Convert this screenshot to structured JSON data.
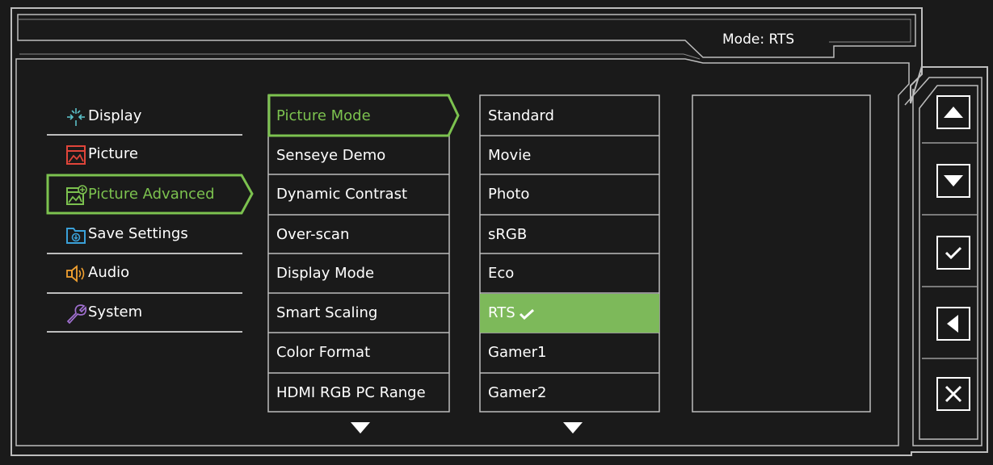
{
  "header": {
    "mode_label": "Mode: RTS"
  },
  "menu1": [
    {
      "label": "Display",
      "icon": "display-icon",
      "color": "#5bc0c8"
    },
    {
      "label": "Picture",
      "icon": "picture-icon",
      "color": "#e0453a"
    },
    {
      "label": "Picture Advanced",
      "icon": "picture-advanced-icon",
      "color": "#7cc24f",
      "active": true
    },
    {
      "label": "Save Settings",
      "icon": "save-settings-icon",
      "color": "#3aa0d8"
    },
    {
      "label": "Audio",
      "icon": "audio-icon",
      "color": "#f0a030"
    },
    {
      "label": "System",
      "icon": "system-icon",
      "color": "#a070d0"
    }
  ],
  "menu2": [
    {
      "label": "Picture Mode",
      "active": true
    },
    {
      "label": "Senseye Demo"
    },
    {
      "label": "Dynamic Contrast"
    },
    {
      "label": "Over-scan"
    },
    {
      "label": "Display Mode"
    },
    {
      "label": "Smart Scaling"
    },
    {
      "label": "Color Format"
    },
    {
      "label": "HDMI RGB PC Range"
    }
  ],
  "menu3": [
    {
      "label": "Standard"
    },
    {
      "label": "Movie"
    },
    {
      "label": "Photo"
    },
    {
      "label": "sRGB"
    },
    {
      "label": "Eco"
    },
    {
      "label": "RTS",
      "selected": true
    },
    {
      "label": "Gamer1"
    },
    {
      "label": "Gamer2"
    }
  ],
  "side_buttons": [
    {
      "name": "up-button",
      "icon": "triangle-up-icon"
    },
    {
      "name": "down-button",
      "icon": "triangle-down-icon"
    },
    {
      "name": "confirm-button",
      "icon": "checkmark-icon"
    },
    {
      "name": "back-button",
      "icon": "triangle-left-icon"
    },
    {
      "name": "exit-button",
      "icon": "close-icon"
    }
  ],
  "colors": {
    "background": "#1a1a1a",
    "border": "#c8c8c8",
    "accent_green": "#7cc24f",
    "selected_fill": "#7db95a"
  }
}
